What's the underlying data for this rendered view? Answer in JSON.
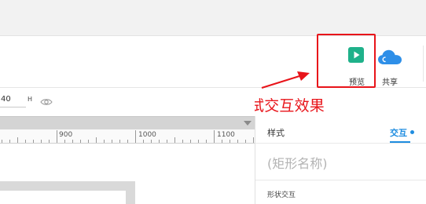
{
  "toolbar": {
    "preview_label": "预览",
    "share_label": "共享"
  },
  "annotation": {
    "text": "点击预览前往浏览器测试交互效果",
    "color": "#e8141a"
  },
  "properties": {
    "height_value": "40",
    "height_label": "H"
  },
  "ruler": {
    "labels": [
      "900",
      "1000",
      "1100"
    ]
  },
  "panel": {
    "tabs": [
      {
        "label": "样式",
        "active": false
      },
      {
        "label": "交互",
        "active": true
      }
    ],
    "shape_name_placeholder": "(矩形名称)",
    "section_title": "形状交互"
  },
  "icons": {
    "preview": "play-icon",
    "share": "cloud-icon",
    "visibility": "eye-icon"
  },
  "colors": {
    "accent_blue": "#1f8de0",
    "preview_green": "#1fb18a",
    "cloud_blue": "#2e8fe8",
    "annotation_red": "#e8141a"
  }
}
